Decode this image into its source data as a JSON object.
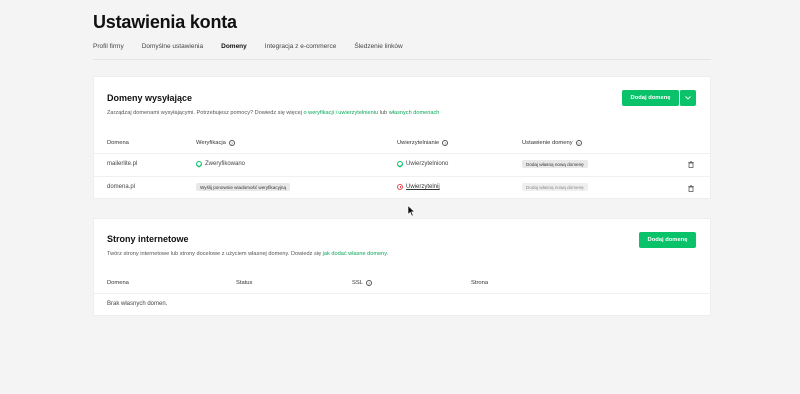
{
  "page": {
    "title": "Ustawienia konta"
  },
  "tabs": [
    {
      "label": "Profil firmy",
      "active": false
    },
    {
      "label": "Domyślne ustawienia",
      "active": false
    },
    {
      "label": "Domeny",
      "active": true
    },
    {
      "label": "Integracja z e-commerce",
      "active": false
    },
    {
      "label": "Śledzenie linków",
      "active": false
    }
  ],
  "sending": {
    "title": "Domeny wysyłające",
    "desc_prefix": "Zarządzaj domenami wysyłającymi. Potrzebujesz pomocy? Dowiedz się więcej ",
    "desc_link1": "o weryfikacji i uwierzytelnieniu",
    "desc_mid": " lub ",
    "desc_link2": "własnych domenach",
    "add_button": "Dodaj domenę",
    "headers": {
      "domain": "Domena",
      "verification": "Weryfikacja",
      "authentication": "Uwierzytelnianie",
      "domain_setting": "Ustawienie domeny"
    },
    "rows": [
      {
        "domain": "mailerlite.pl",
        "verification": "Zweryfikowano",
        "authentication": "Uwierzytelniono",
        "setting": "Dodaj własną nową domenę"
      },
      {
        "domain": "domena.pl",
        "verification": "Wyślij ponownie wiadomość weryfikacyjną",
        "authentication": "Uwierzytelnij",
        "setting": "Dodaj własną nową domenę"
      }
    ]
  },
  "websites": {
    "title": "Strony internetowe",
    "desc_prefix": "Twórz strony internetowe lub strony docelowe z użyciem własnej domeny. Dowiedz się ",
    "desc_link": "jak dodać własne domeny",
    "desc_suffix": ".",
    "add_button": "Dodaj domenę",
    "headers": {
      "domain": "Domena",
      "status": "Status",
      "ssl": "SSL",
      "page": "Strona"
    },
    "empty": "Brak własnych domen."
  },
  "colors": {
    "accent": "#09c269",
    "error": "#e5484d"
  }
}
